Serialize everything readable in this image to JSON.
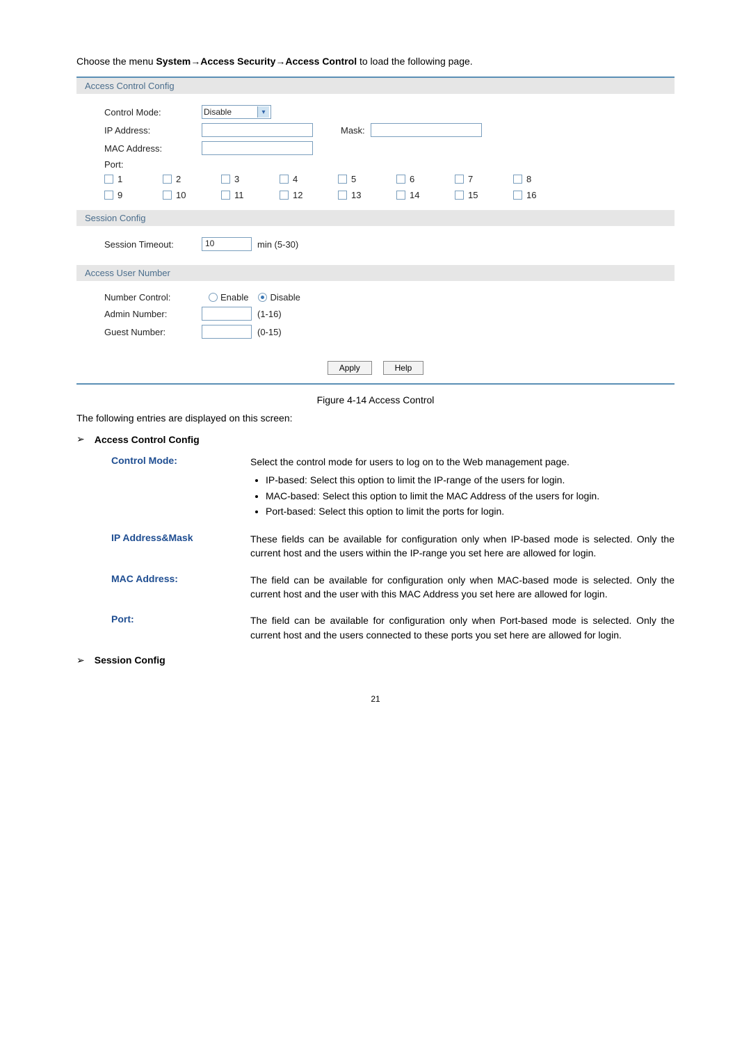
{
  "intro": {
    "prefix": "Choose the menu ",
    "bold_path": "System→Access Security→Access Control",
    "suffix": " to load the following page."
  },
  "config": {
    "access_control": {
      "header": "Access Control Config",
      "control_mode_label": "Control Mode:",
      "control_mode_value": "Disable",
      "ip_label": "IP Address:",
      "mask_label": "Mask:",
      "mac_label": "MAC Address:",
      "port_label": "Port:",
      "ports": [
        "1",
        "2",
        "3",
        "4",
        "5",
        "6",
        "7",
        "8",
        "9",
        "10",
        "11",
        "12",
        "13",
        "14",
        "15",
        "16"
      ]
    },
    "session": {
      "header": "Session Config",
      "timeout_label": "Session Timeout:",
      "timeout_value": "10",
      "timeout_hint": "min (5-30)"
    },
    "user_number": {
      "header": "Access User Number",
      "number_control_label": "Number Control:",
      "enable_label": "Enable",
      "disable_label": "Disable",
      "admin_label": "Admin Number:",
      "admin_hint": "(1-16)",
      "guest_label": "Guest Number:",
      "guest_hint": "(0-15)"
    },
    "buttons": {
      "apply": "Apply",
      "help": "Help"
    }
  },
  "figure_caption": "Figure 4-14 Access Control",
  "entries_line": "The following entries are displayed on this screen:",
  "sections": {
    "acc": "Access Control Config",
    "session": "Session Config"
  },
  "defs": {
    "control_mode": {
      "term": "Control Mode:",
      "desc": "Select the control mode for users to log on to the Web management page.",
      "b1": "IP-based: Select this option to limit the IP-range of the users for login.",
      "b2": "MAC-based: Select this option to limit the MAC Address of the users for login.",
      "b3": "Port-based: Select this option to limit the ports for login."
    },
    "ip_mask": {
      "term": "IP Address&Mask",
      "desc": "These fields can be available for configuration only when IP-based mode is selected. Only the current host and the users within the IP-range you set here are allowed for login."
    },
    "mac": {
      "term": "MAC Address:",
      "desc": "The field can be available for configuration only when MAC-based mode is selected. Only the current host and the user with this MAC Address you set here are allowed for login."
    },
    "port": {
      "term": "Port:",
      "desc": "The field can be available for configuration only when Port-based mode is selected. Only the current host and the users connected to these ports you set here are allowed for login."
    }
  },
  "arrow_glyph": "➢",
  "page_number": "21"
}
